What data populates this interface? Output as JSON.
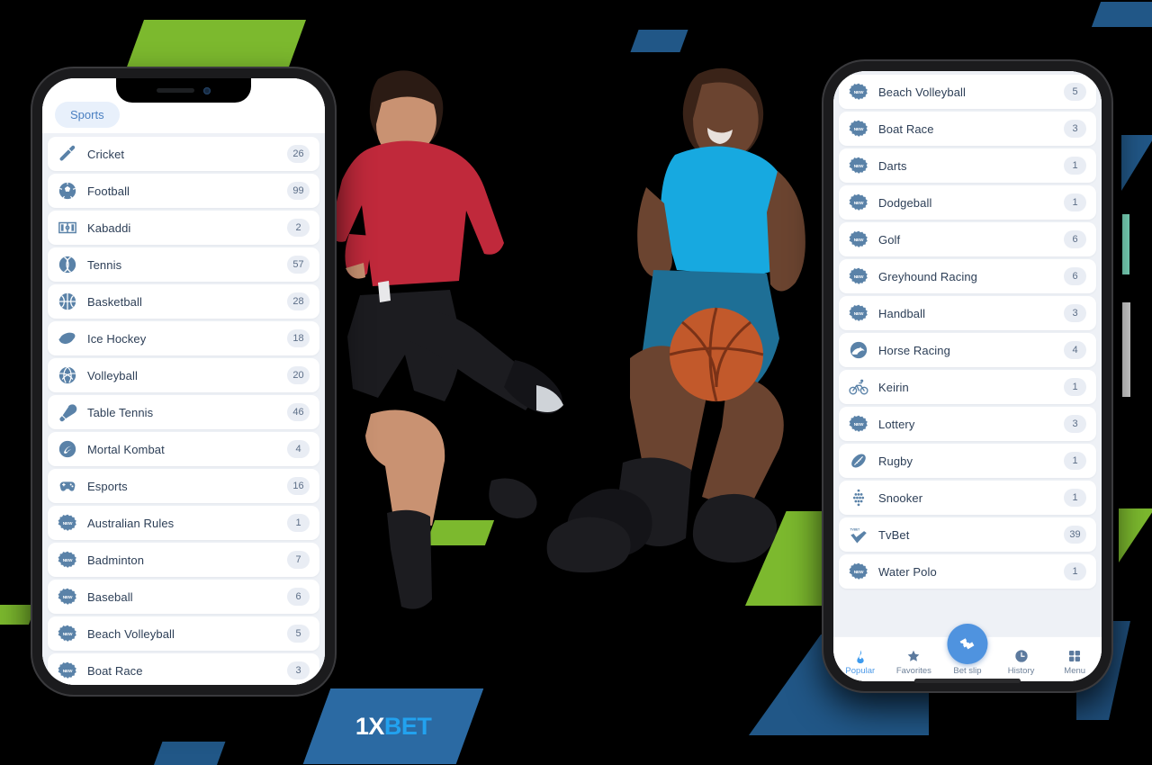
{
  "brand": {
    "name_part1": "1X",
    "name_part2": "BET",
    "colors": {
      "blue_plate": "#2B6AA3",
      "accent_blue": "#22A2EF",
      "deco_green": "#7CB92E",
      "deco_blue": "#215787",
      "badge_bg": "#E9EDF4",
      "icon_blue": "#5A82A8",
      "nav_active": "#4F9BE8"
    }
  },
  "left_phone": {
    "tab_label": "Sports",
    "sports": [
      {
        "name": "Cricket",
        "count": "26",
        "icon": "cricket-bat-icon",
        "new": false
      },
      {
        "name": "Football",
        "count": "99",
        "icon": "soccer-ball-icon",
        "new": false
      },
      {
        "name": "Kabaddi",
        "count": "2",
        "icon": "kabaddi-court-icon",
        "new": false
      },
      {
        "name": "Tennis",
        "count": "57",
        "icon": "tennis-ball-icon",
        "new": false
      },
      {
        "name": "Basketball",
        "count": "28",
        "icon": "basketball-icon",
        "new": false
      },
      {
        "name": "Ice Hockey",
        "count": "18",
        "icon": "hockey-puck-icon",
        "new": false
      },
      {
        "name": "Volleyball",
        "count": "20",
        "icon": "volleyball-icon",
        "new": false
      },
      {
        "name": "Table Tennis",
        "count": "46",
        "icon": "table-tennis-icon",
        "new": false
      },
      {
        "name": "Mortal Kombat",
        "count": "4",
        "icon": "mortal-kombat-icon",
        "new": false
      },
      {
        "name": "Esports",
        "count": "16",
        "icon": "gamepad-icon",
        "new": false
      },
      {
        "name": "Australian Rules",
        "count": "1",
        "icon": "new-badge-icon",
        "new": true
      },
      {
        "name": "Badminton",
        "count": "7",
        "icon": "new-badge-icon",
        "new": true
      },
      {
        "name": "Baseball",
        "count": "6",
        "icon": "new-badge-icon",
        "new": true
      },
      {
        "name": "Beach Volleyball",
        "count": "5",
        "icon": "new-badge-icon",
        "new": true
      },
      {
        "name": "Boat Race",
        "count": "3",
        "icon": "new-badge-icon",
        "new": true
      }
    ]
  },
  "right_phone": {
    "sports": [
      {
        "name": "Beach Volleyball",
        "count": "5",
        "icon": "new-badge-icon",
        "new": true
      },
      {
        "name": "Boat Race",
        "count": "3",
        "icon": "new-badge-icon",
        "new": true
      },
      {
        "name": "Darts",
        "count": "1",
        "icon": "new-badge-icon",
        "new": true
      },
      {
        "name": "Dodgeball",
        "count": "1",
        "icon": "new-badge-icon",
        "new": true
      },
      {
        "name": "Golf",
        "count": "6",
        "icon": "new-badge-icon",
        "new": true
      },
      {
        "name": "Greyhound Racing",
        "count": "6",
        "icon": "new-badge-icon",
        "new": true
      },
      {
        "name": "Handball",
        "count": "3",
        "icon": "new-badge-icon",
        "new": true
      },
      {
        "name": "Horse Racing",
        "count": "4",
        "icon": "horse-racing-icon",
        "new": false
      },
      {
        "name": "Keirin",
        "count": "1",
        "icon": "bicycle-icon",
        "new": false
      },
      {
        "name": "Lottery",
        "count": "3",
        "icon": "new-badge-icon",
        "new": true
      },
      {
        "name": "Rugby",
        "count": "1",
        "icon": "rugby-ball-icon",
        "new": false
      },
      {
        "name": "Snooker",
        "count": "1",
        "icon": "snooker-balls-icon",
        "new": false
      },
      {
        "name": "TvBet",
        "count": "39",
        "icon": "tvbet-check-icon",
        "new": false
      },
      {
        "name": "Water Polo",
        "count": "1",
        "icon": "new-badge-icon",
        "new": true
      }
    ],
    "nav": [
      {
        "label": "Popular",
        "icon": "flame-icon",
        "active": true
      },
      {
        "label": "Favorites",
        "icon": "star-icon",
        "active": false
      },
      {
        "label": "Bet slip",
        "icon": "bet-slip-icon",
        "active": false
      },
      {
        "label": "History",
        "icon": "clock-icon",
        "active": false
      },
      {
        "label": "Menu",
        "icon": "grid-icon",
        "active": false
      }
    ]
  }
}
